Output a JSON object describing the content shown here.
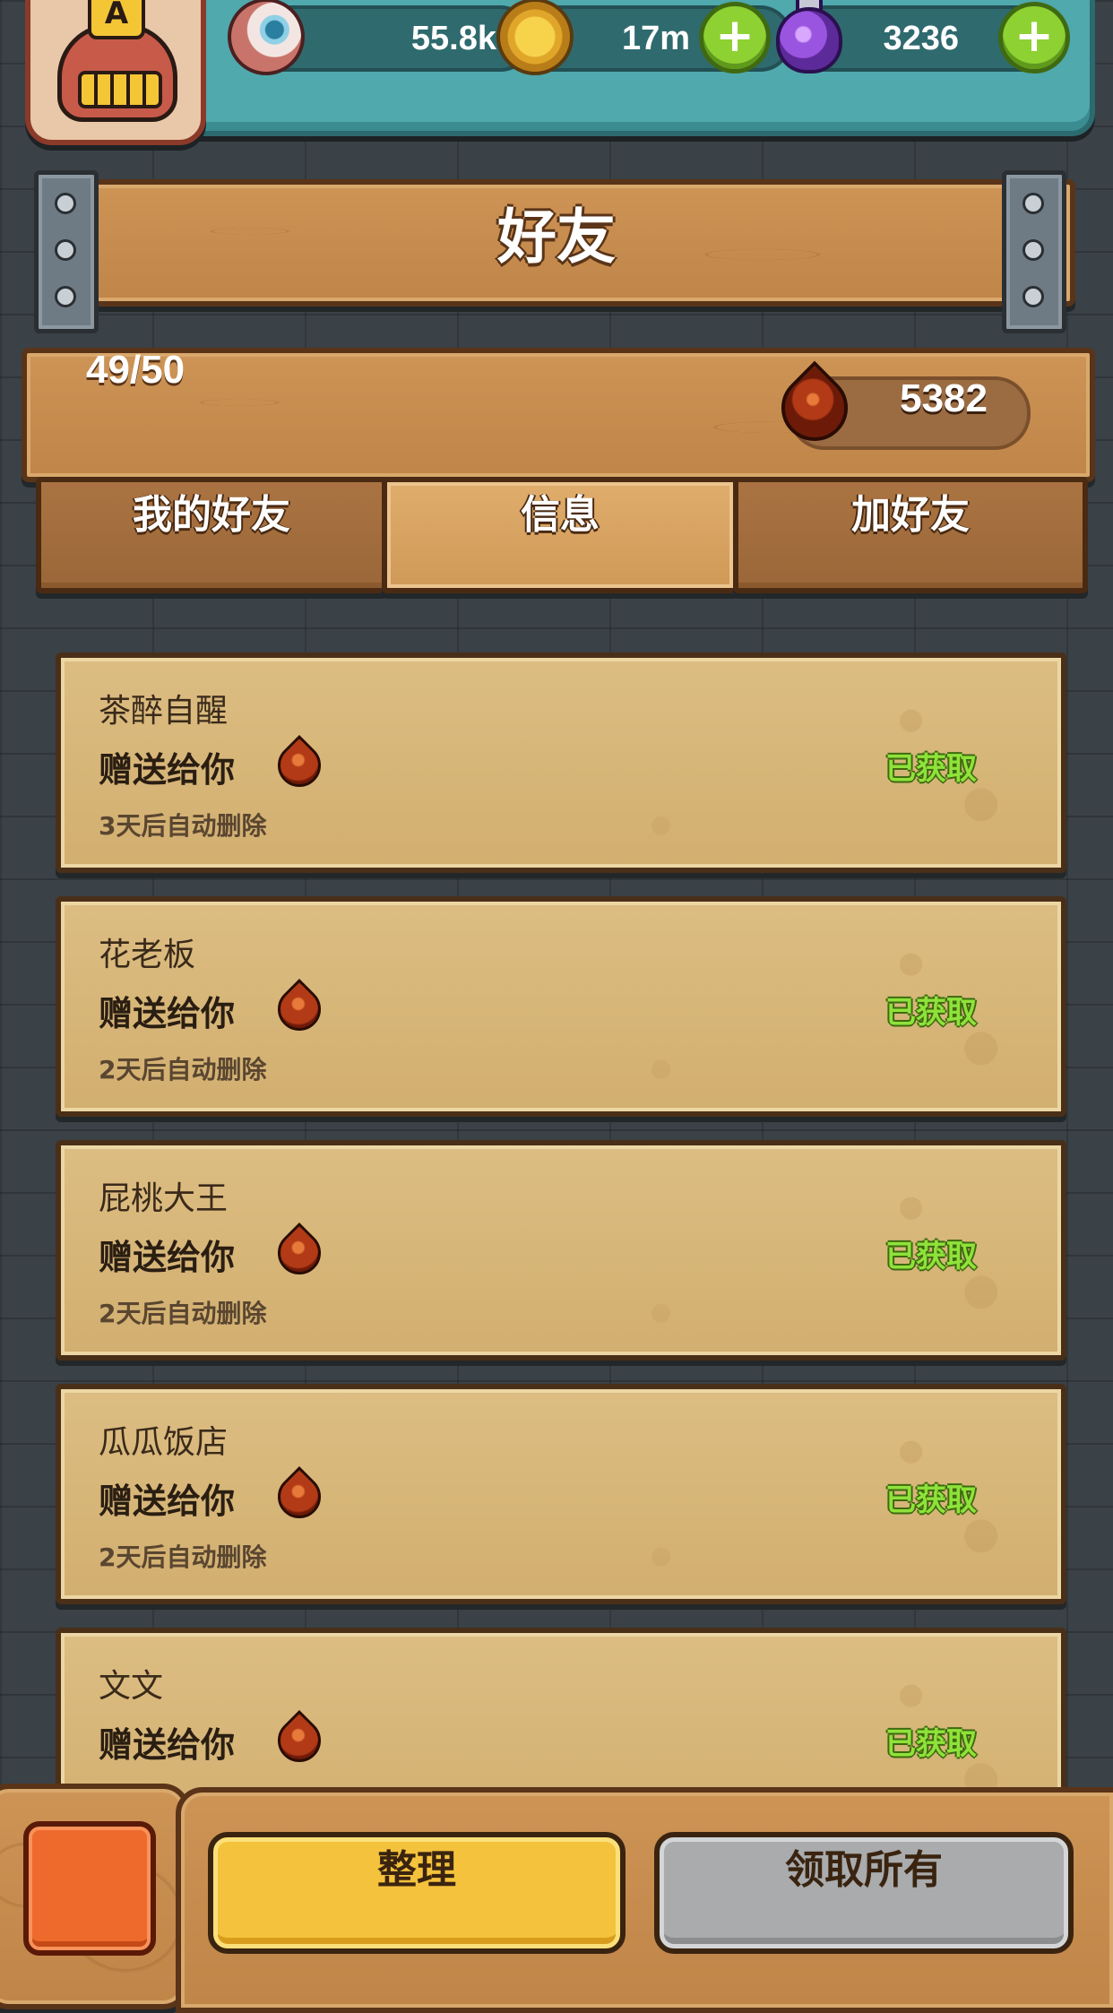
{
  "topbar": {
    "eyes": "55.8k",
    "coins": "17m",
    "potions": "3236",
    "icons": [
      "avatar",
      "eye-icon",
      "coin-icon",
      "plus-icon",
      "potion-icon",
      "plus-icon"
    ]
  },
  "avatar": {
    "letter": "A"
  },
  "header": {
    "title": "好友"
  },
  "stats": {
    "friend_count": "49/50",
    "blood_total": "5382"
  },
  "tabs": [
    {
      "label": "我的好友",
      "active": false
    },
    {
      "label": "信息",
      "active": true
    },
    {
      "label": "加好友",
      "active": false
    }
  ],
  "messages": [
    {
      "name": "茶醉自醒",
      "action": "赠送给你",
      "expire": "3天后自动删除",
      "status": "已获取"
    },
    {
      "name": "花老板",
      "action": "赠送给你",
      "expire": "2天后自动删除",
      "status": "已获取"
    },
    {
      "name": "屁桃大王",
      "action": "赠送给你",
      "expire": "2天后自动删除",
      "status": "已获取"
    },
    {
      "name": "瓜瓜饭店",
      "action": "赠送给你",
      "expire": "2天后自动删除",
      "status": "已获取"
    },
    {
      "name": "文文",
      "action": "赠送给你",
      "expire": "",
      "status": "已获取"
    }
  ],
  "footer": {
    "organize_label": "整理",
    "claim_all_label": "领取所有"
  },
  "colors": {
    "status_green": "#8fe23a",
    "wood": "#c48a4d",
    "yellow_button": "#f4c23c",
    "gray_button": "#a9abad"
  }
}
